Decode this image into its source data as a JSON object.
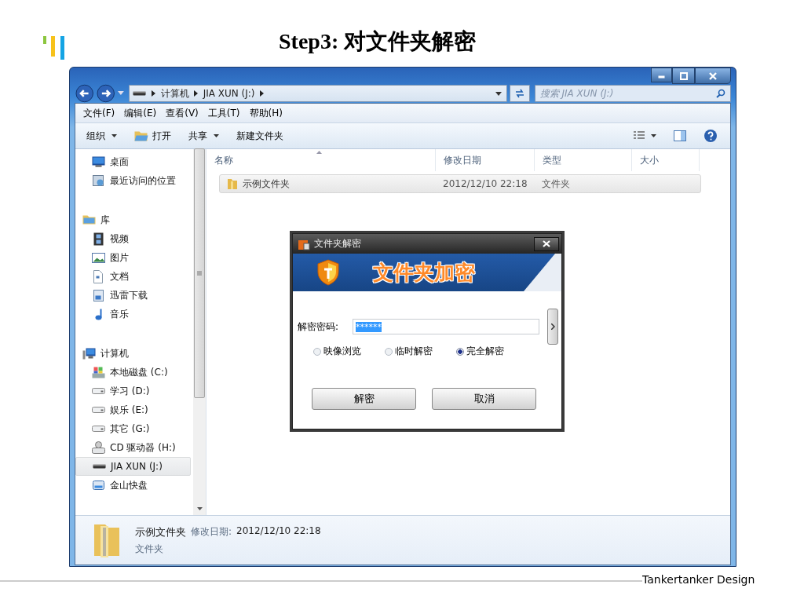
{
  "slide": {
    "title": "Step3: 对文件夹解密",
    "footer": "Tankertanker Design"
  },
  "explorer": {
    "address": {
      "crumbs": [
        "计算机",
        "JIA XUN (J:)"
      ]
    },
    "search": {
      "placeholder": "搜索 JIA XUN (J:)"
    },
    "menu": [
      "文件(F)",
      "编辑(E)",
      "查看(V)",
      "工具(T)",
      "帮助(H)"
    ],
    "toolbar": [
      {
        "label": "组织",
        "kind": "dropdown"
      },
      {
        "label": "打开",
        "kind": "open"
      },
      {
        "label": "共享",
        "kind": "dropdown"
      },
      {
        "label": "新建文件夹",
        "kind": "plain"
      }
    ],
    "nav": [
      {
        "children": [
          {
            "label": "桌面",
            "kind": "desktop",
            "selected": false
          },
          {
            "label": "最近访问的位置",
            "kind": "recent",
            "selected": false
          }
        ]
      },
      {
        "label": "库",
        "kind": "library",
        "children": [
          {
            "label": "视频",
            "kind": "video",
            "selected": false
          },
          {
            "label": "图片",
            "kind": "picture",
            "selected": false
          },
          {
            "label": "文档",
            "kind": "document",
            "selected": false
          },
          {
            "label": "迅雷下载",
            "kind": "download",
            "selected": false
          },
          {
            "label": "音乐",
            "kind": "music",
            "selected": false
          }
        ]
      },
      {
        "label": "计算机",
        "kind": "computer",
        "children": [
          {
            "label": "本地磁盘 (C:)",
            "kind": "system",
            "selected": false
          },
          {
            "label": "学习 (D:)",
            "kind": "drive",
            "selected": false
          },
          {
            "label": "娱乐 (E:)",
            "kind": "drive",
            "selected": false
          },
          {
            "label": "其它 (G:)",
            "kind": "drive",
            "selected": false
          },
          {
            "label": "CD 驱动器 (H:)",
            "kind": "cd",
            "selected": false
          },
          {
            "label": "JIA XUN (J:)",
            "kind": "usb",
            "selected": true
          },
          {
            "label": "金山快盘",
            "kind": "cloud",
            "selected": false
          }
        ]
      }
    ],
    "columns": [
      {
        "label": "名称",
        "sorted": true
      },
      {
        "label": "修改日期",
        "sorted": false
      },
      {
        "label": "类型",
        "sorted": false
      },
      {
        "label": "大小",
        "sorted": false
      }
    ],
    "rows": [
      {
        "name": "示例文件夹",
        "modified": "2012/12/10 22:18",
        "type": "文件夹",
        "selected": true
      }
    ],
    "details": {
      "name": "示例文件夹",
      "modified_label": "修改日期:",
      "modified": "2012/12/10 22:18",
      "type": "文件夹"
    }
  },
  "dialog": {
    "title": "文件夹解密",
    "banner": "文件夹加密",
    "password_label": "解密密码:",
    "password": "******",
    "options": [
      {
        "label": "映像浏览",
        "selected": false
      },
      {
        "label": "临时解密",
        "selected": false
      },
      {
        "label": "完全解密",
        "selected": true
      }
    ],
    "buttons": [
      "解密",
      "取消"
    ]
  }
}
